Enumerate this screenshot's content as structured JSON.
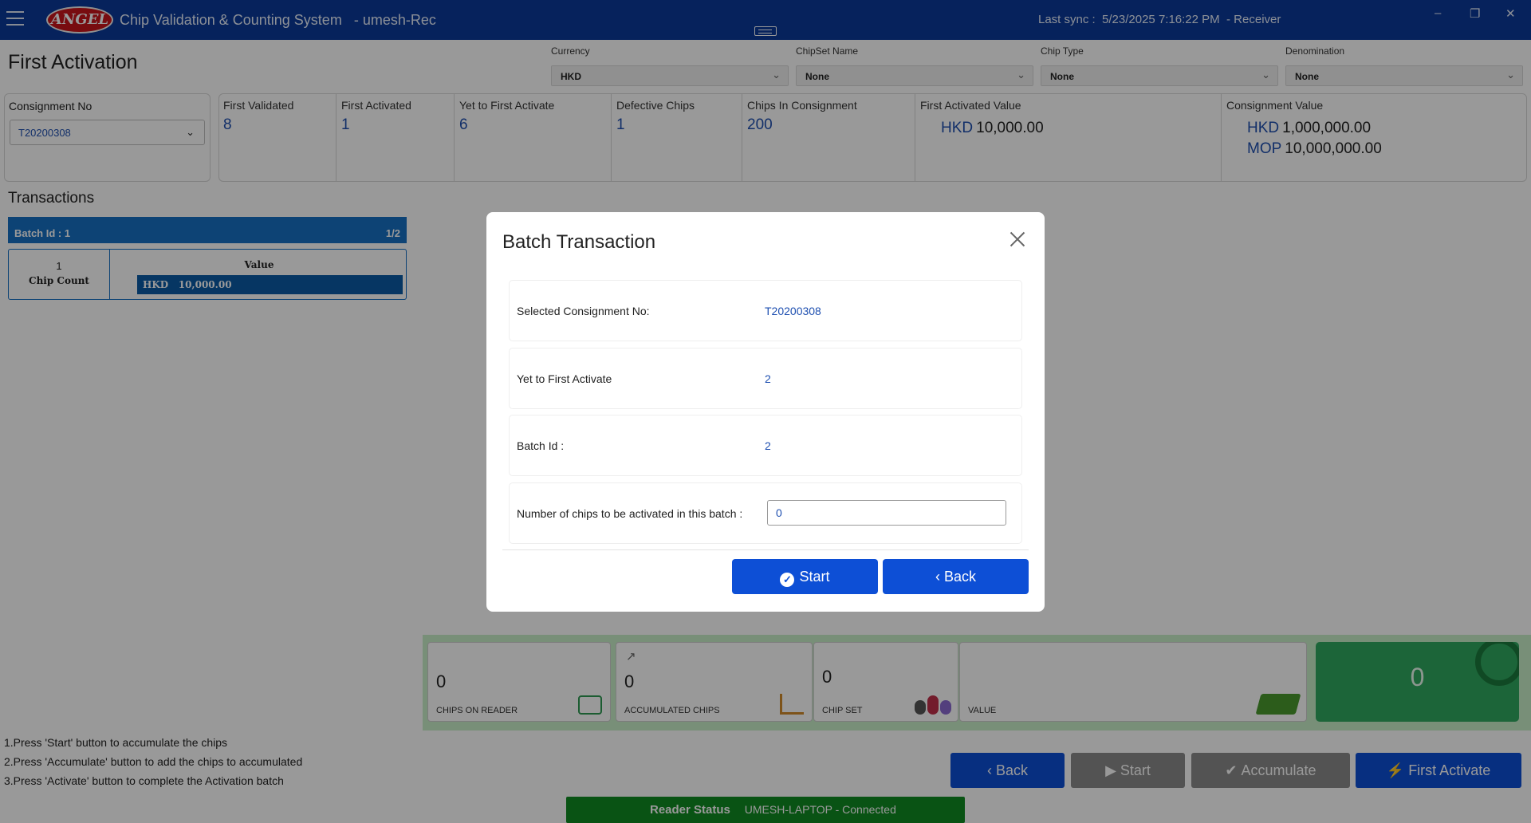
{
  "titlebar": {
    "logo": "ANGEL",
    "app_title": "Chip Validation & Counting System",
    "user": "- umesh-Rec",
    "sync_label": "Last sync :",
    "sync_time": "5/23/2025 7:16:22 PM",
    "role": "- Receiver",
    "minimize": "–",
    "restore": "❐",
    "close": "✕"
  },
  "page": {
    "title": "First Activation"
  },
  "filters": [
    {
      "label": "Currency",
      "value": "HKD"
    },
    {
      "label": "ChipSet Name",
      "value": "None"
    },
    {
      "label": "Chip Type",
      "value": "None"
    },
    {
      "label": "Denomination",
      "value": "None"
    }
  ],
  "consignment": {
    "label": "Consignment No",
    "value": "T20200308"
  },
  "stats": [
    {
      "label": "First Validated",
      "value": "8"
    },
    {
      "label": "First Activated",
      "value": "1"
    },
    {
      "label": "Yet to First Activate",
      "value": "6"
    },
    {
      "label": "Defective Chips",
      "value": "1"
    },
    {
      "label": "Chips In Consignment",
      "value": "200"
    }
  ],
  "first_activated_value": {
    "label": "First Activated Value",
    "currency": "HKD",
    "amount": "10,000.00"
  },
  "consignment_value": {
    "label": "Consignment Value",
    "lines": [
      {
        "currency": "HKD",
        "amount": "1,000,000.00"
      },
      {
        "currency": "MOP",
        "amount": "10,000,000.00"
      }
    ]
  },
  "transactions": {
    "title": "Transactions",
    "batch_label": "Batch Id :  1",
    "page": "1/2",
    "chip_count_value": "1",
    "chip_count_label": "Chip Count",
    "value_header": "Value",
    "value_currency": "HKD",
    "value_amount": "10,000.00"
  },
  "tiles": {
    "chips_on_reader": {
      "value": "0",
      "label": "CHIPS ON READER"
    },
    "accumulated_chips": {
      "value": "0",
      "label": "ACCUMULATED CHIPS"
    },
    "chip_set": {
      "value": "0",
      "label": "CHIP SET"
    },
    "value": {
      "label": "VALUE"
    },
    "total": {
      "value": "0"
    }
  },
  "instructions": [
    "1.Press 'Start' button to accumulate the chips",
    "2.Press 'Accumulate' button to add the chips to accumulated",
    "3.Press 'Activate' button to complete the Activation batch"
  ],
  "actions": {
    "back": "Back",
    "start": "Start",
    "accumulate": "Accumulate",
    "first_activate": "First Activate"
  },
  "reader": {
    "label": "Reader Status",
    "status": "UMESH-LAPTOP - Connected"
  },
  "modal": {
    "title": "Batch Transaction",
    "rows": [
      {
        "label": "Selected Consignment No:",
        "value": "T20200308"
      },
      {
        "label": "Yet to First Activate",
        "value": "2"
      },
      {
        "label": "Batch Id :",
        "value": "2"
      }
    ],
    "input_label": "Number of chips to be activated in this batch :",
    "input_value": "0",
    "start": "Start",
    "back": "Back"
  },
  "colors": {
    "titlebar": "#0a3a9a",
    "primary": "#0d4fd6",
    "accent_text": "#1e4fb0",
    "reader_ok": "#0f8a22",
    "tile_total": "#2fa860"
  }
}
